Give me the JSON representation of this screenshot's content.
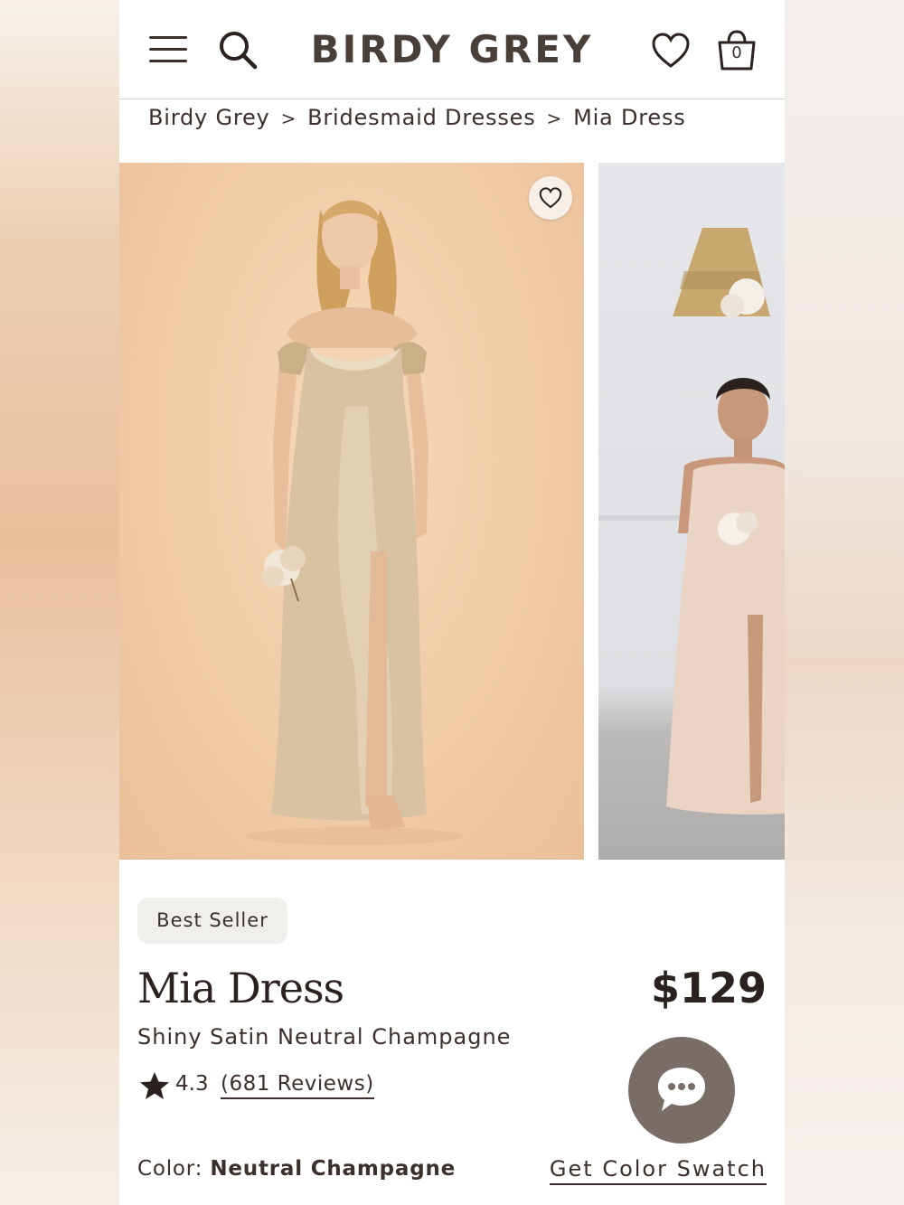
{
  "header": {
    "brand": "BIRDY GREY",
    "bag_count": "0"
  },
  "breadcrumb": {
    "items": [
      "Birdy Grey",
      "Bridesmaid Dresses",
      "Mia Dress"
    ],
    "separator": ">"
  },
  "product": {
    "badge": "Best Seller",
    "name": "Mia Dress",
    "price": "$129",
    "variant": "Shiny Satin Neutral Champagne",
    "rating": "4.3",
    "reviews": "(681 Reviews)",
    "color_label": "Color:",
    "color_value": "Neutral Champagne",
    "swatch_link": "Get Color Swatch"
  },
  "icons": {
    "menu": "menu-icon",
    "search": "search-icon",
    "wishlist": "heart-icon",
    "bag": "bag-icon",
    "star": "star-icon",
    "chat": "chat-icon"
  },
  "colors": {
    "text": "#3b302b",
    "chat_button": "#7a6d68",
    "badge_bg": "#f1efec",
    "photo_bg": "#f0cca7"
  }
}
